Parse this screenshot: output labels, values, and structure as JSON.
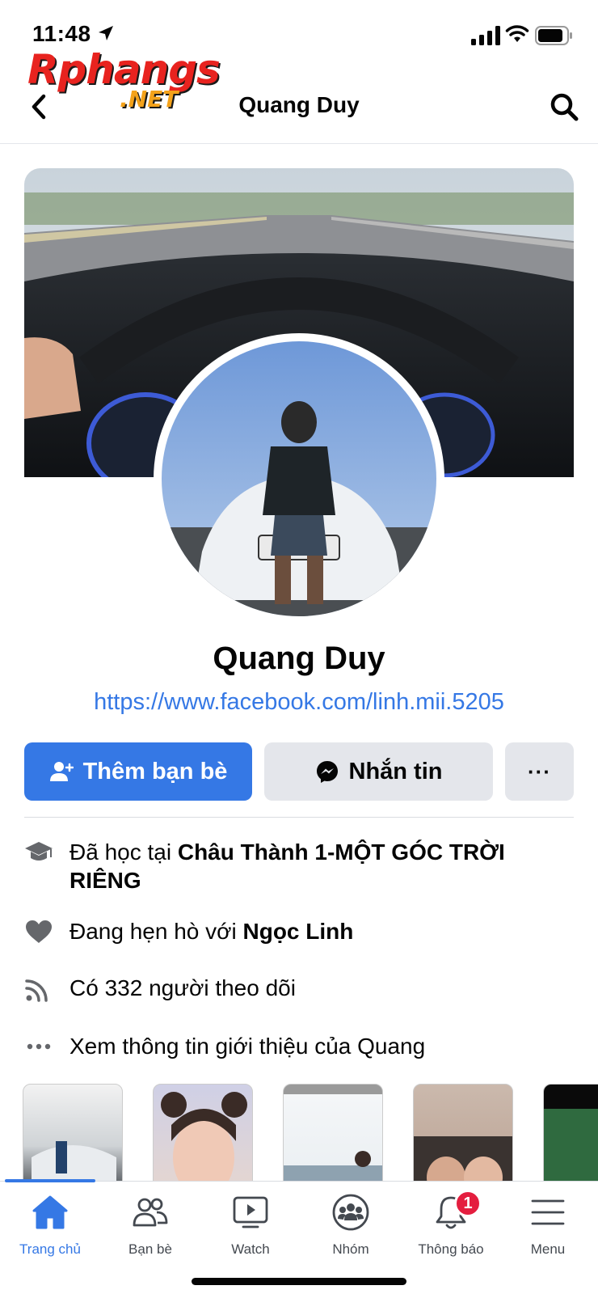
{
  "status_bar": {
    "time": "11:48"
  },
  "watermark": {
    "brand": "Rphangs",
    "suffix": ".NET"
  },
  "header": {
    "title": "Quang Duy"
  },
  "profile": {
    "name": "Quang Duy",
    "link": "https://www.facebook.com/linh.mii.5205"
  },
  "actions": {
    "add_friend": "Thêm bạn bè",
    "message": "Nhắn tin",
    "more": "···"
  },
  "info": {
    "education_prefix": "Đã học tại ",
    "education_place": "Châu Thành 1-MỘT GÓC TRỜI RIÊNG",
    "relationship_prefix": "Đang hẹn hò với ",
    "relationship_partner": "Ngọc Linh",
    "followers": "Có 332 người theo dõi",
    "see_about": "Xem thông tin giới thiệu của Quang"
  },
  "tabs": [
    {
      "label": "Trang chủ",
      "icon": "home-icon",
      "active": true
    },
    {
      "label": "Bạn bè",
      "icon": "friends-icon"
    },
    {
      "label": "Watch",
      "icon": "watch-icon"
    },
    {
      "label": "Nhóm",
      "icon": "groups-icon"
    },
    {
      "label": "Thông báo",
      "icon": "bell-icon",
      "badge": "1"
    },
    {
      "label": "Menu",
      "icon": "menu-icon"
    }
  ],
  "colors": {
    "accent": "#3578e5",
    "button_gray": "#e4e6eb",
    "badge": "#e41e3f"
  }
}
